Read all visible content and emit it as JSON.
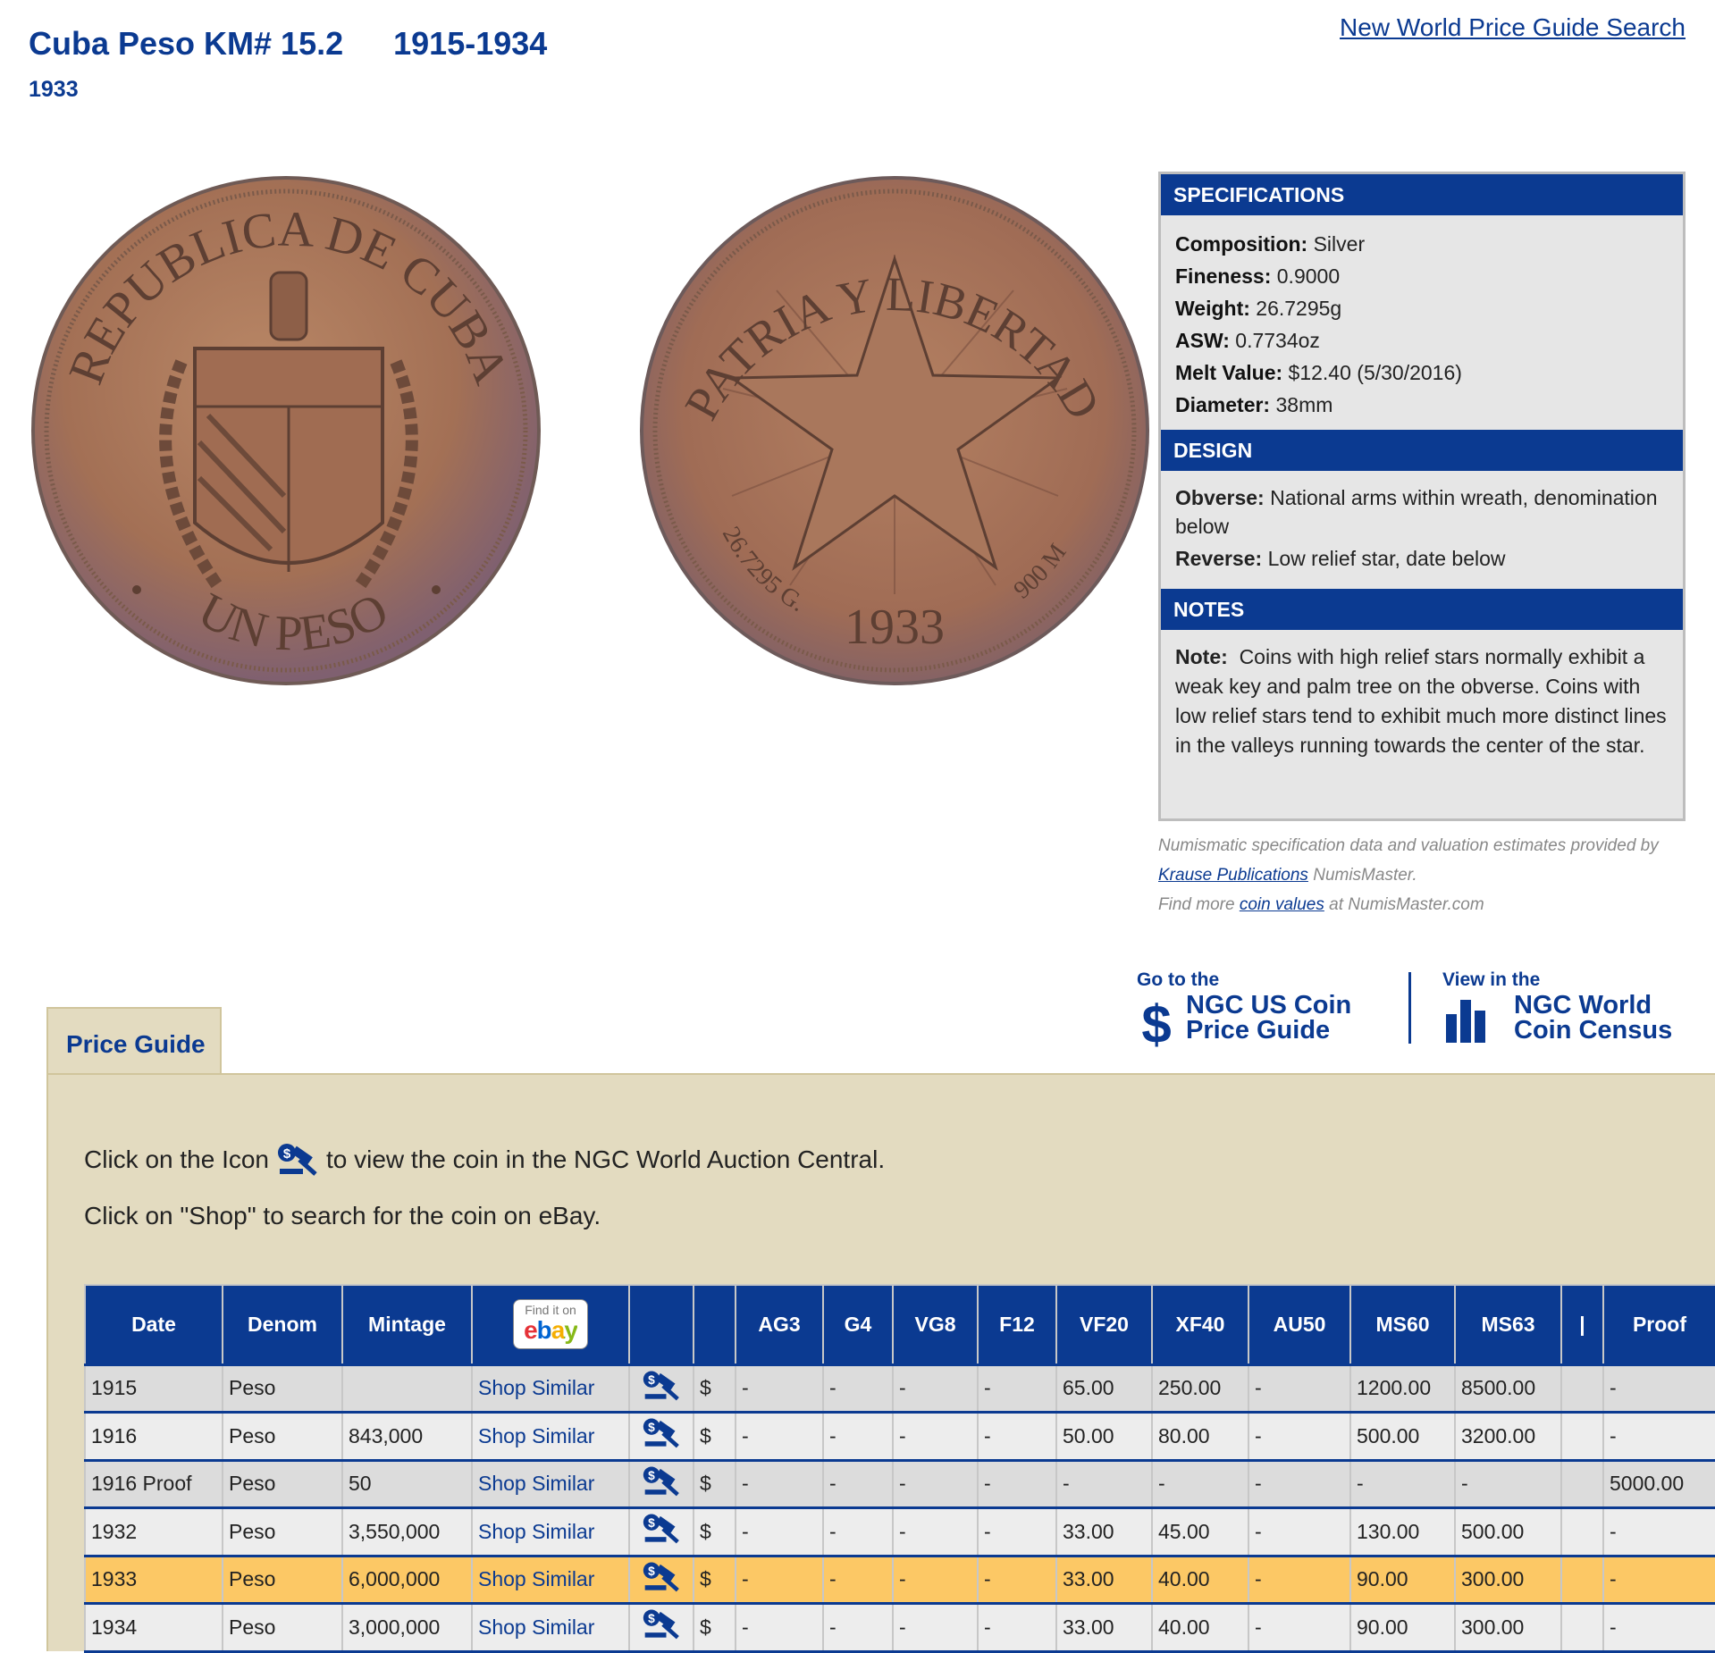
{
  "header": {
    "title": "Cuba Peso KM# 15.2",
    "years": "1915-1934",
    "subtitle": "1933",
    "search_link": "New World Price Guide Search"
  },
  "coins": {
    "obverse": {
      "legend_top": "REPUBLICA DE CUBA",
      "legend_bottom": "UN PESO"
    },
    "reverse": {
      "legend_top": "PATRIA Y LIBERTAD",
      "legend_left": "26.7295 G.",
      "year": "1933",
      "legend_right": "900 M"
    }
  },
  "specifications": {
    "heading": "SPECIFICATIONS",
    "items": [
      {
        "label": "Composition:",
        "value": "Silver"
      },
      {
        "label": "Fineness:",
        "value": "0.9000"
      },
      {
        "label": "Weight:",
        "value": "26.7295g"
      },
      {
        "label": "ASW:",
        "value": "0.7734oz"
      },
      {
        "label": "Melt Value:",
        "value": "$12.40 (5/30/2016)"
      },
      {
        "label": "Diameter:",
        "value": "38mm"
      }
    ],
    "design_heading": "DESIGN",
    "design": [
      {
        "label": "Obverse:",
        "value": "National arms within wreath, denomination below"
      },
      {
        "label": "Reverse:",
        "value": "Low relief star, date below"
      }
    ],
    "notes_heading": "NOTES",
    "notes": {
      "label": "Note:",
      "value": "Coins with high relief stars normally exhibit a weak key and palm tree on the obverse. Coins with low relief stars tend to exhibit much more distinct lines in the valleys running towards the center of the star."
    }
  },
  "provider": {
    "line1": "Numismatic specification data and valuation estimates provided by",
    "link1": "Krause Publications",
    "line2_suffix": "NumisMaster.",
    "line3_prefix": "Find more",
    "link2": "coin values",
    "line3_suffix": "at NumisMaster.com"
  },
  "external_links": {
    "us_small": "Go to the",
    "us_big": "NGC US Coin\nPrice Guide",
    "census_small": "View in the",
    "census_big": "NGC World\nCoin Census"
  },
  "price_guide": {
    "tab_label": "Price Guide",
    "instruction1_pre": "Click on the Icon",
    "instruction1_post": "to view the coin in the NGC World Auction Central.",
    "instruction2": "Click on \"Shop\" to search for the coin on eBay.",
    "ebay_badge": {
      "top": "Find it on",
      "brand": "ebay"
    },
    "headers": [
      "Date",
      "Denom",
      "Mintage",
      "",
      "",
      "",
      "AG3",
      "G4",
      "VG8",
      "F12",
      "VF20",
      "XF40",
      "AU50",
      "MS60",
      "MS63",
      "|",
      "Proof"
    ],
    "rows": [
      {
        "date": "1915",
        "denom": "Peso",
        "mintage": "",
        "shop": "Shop Similar",
        "cur": "$",
        "ag3": "-",
        "g4": "-",
        "vg8": "-",
        "f12": "-",
        "vf20": "65.00",
        "xf40": "250.00",
        "au50": "-",
        "ms60": "1200.00",
        "ms63": "8500.00",
        "sep": "",
        "proof": "-"
      },
      {
        "date": "1916",
        "denom": "Peso",
        "mintage": "843,000",
        "shop": "Shop Similar",
        "cur": "$",
        "ag3": "-",
        "g4": "-",
        "vg8": "-",
        "f12": "-",
        "vf20": "50.00",
        "xf40": "80.00",
        "au50": "-",
        "ms60": "500.00",
        "ms63": "3200.00",
        "sep": "",
        "proof": "-"
      },
      {
        "date": "1916 Proof",
        "denom": "Peso",
        "mintage": "50",
        "shop": "Shop Similar",
        "cur": "$",
        "ag3": "-",
        "g4": "-",
        "vg8": "-",
        "f12": "-",
        "vf20": "-",
        "xf40": "-",
        "au50": "-",
        "ms60": "-",
        "ms63": "-",
        "sep": "",
        "proof": "5000.00"
      },
      {
        "date": "1932",
        "denom": "Peso",
        "mintage": "3,550,000",
        "shop": "Shop Similar",
        "cur": "$",
        "ag3": "-",
        "g4": "-",
        "vg8": "-",
        "f12": "-",
        "vf20": "33.00",
        "xf40": "45.00",
        "au50": "-",
        "ms60": "130.00",
        "ms63": "500.00",
        "sep": "",
        "proof": "-"
      },
      {
        "date": "1933",
        "denom": "Peso",
        "mintage": "6,000,000",
        "shop": "Shop Similar",
        "cur": "$",
        "ag3": "-",
        "g4": "-",
        "vg8": "-",
        "f12": "-",
        "vf20": "33.00",
        "xf40": "40.00",
        "au50": "-",
        "ms60": "90.00",
        "ms63": "300.00",
        "sep": "",
        "proof": "-"
      },
      {
        "date": "1934",
        "denom": "Peso",
        "mintage": "3,000,000",
        "shop": "Shop Similar",
        "cur": "$",
        "ag3": "-",
        "g4": "-",
        "vg8": "-",
        "f12": "-",
        "vf20": "33.00",
        "xf40": "40.00",
        "au50": "-",
        "ms60": "90.00",
        "ms63": "300.00",
        "sep": "",
        "proof": "-"
      }
    ],
    "highlight_row": 4
  },
  "colors": {
    "brand_blue": "#0b3a91",
    "panel_tan": "#e3dbc0",
    "highlight": "#fcc865",
    "coin_copper": "#a77558"
  },
  "icons": {
    "auction": "gavel-icon",
    "us_guide": "dollar-icon",
    "census": "bar-chart-icon"
  }
}
